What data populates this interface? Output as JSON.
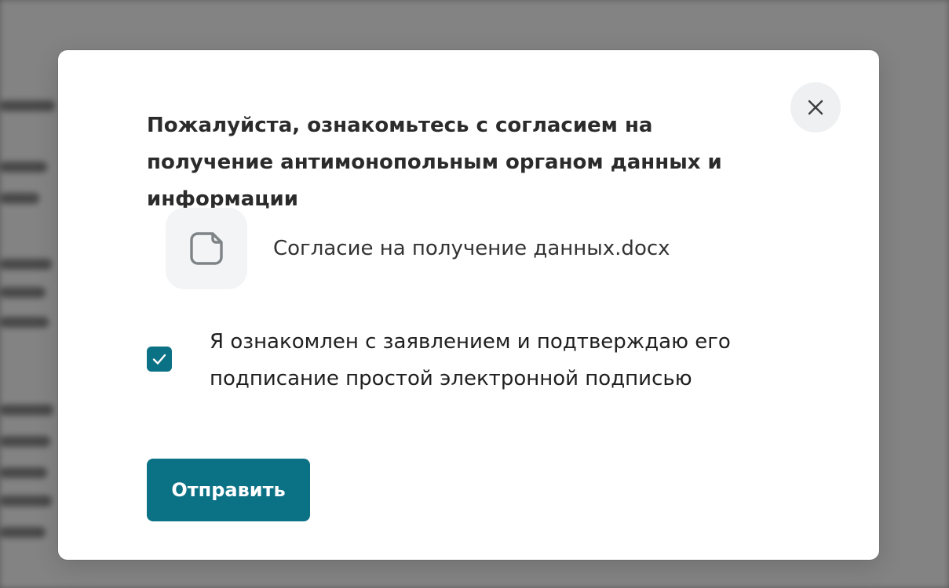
{
  "modal": {
    "title": "Пожалуйста, ознакомьтесь с согласием на получение антимонопольным органом данных и информации",
    "close_icon": "close-icon",
    "file": {
      "icon": "document-icon",
      "name": "Согласие на получение данных.docx"
    },
    "consent": {
      "checked": true,
      "label": "Я ознакомлен с заявлением и подтверждаю его подписание простой электронной подписью"
    },
    "submit_label": "Отправить"
  },
  "colors": {
    "accent": "#0b7185",
    "overlay": "#9a9a9a",
    "modal_background": "#ffffff",
    "close_button_background": "#eef0f2",
    "file_icon_background": "#f3f4f6"
  }
}
